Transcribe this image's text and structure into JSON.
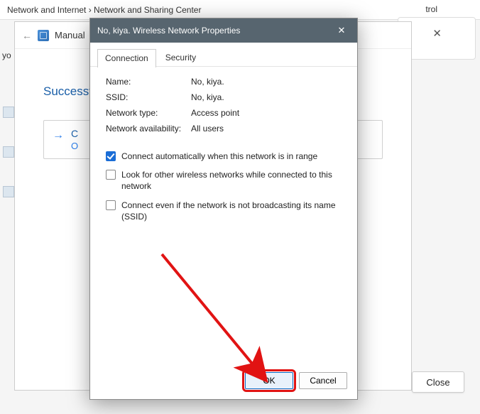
{
  "bg": {
    "breadcrumb": "Network and Internet  ›  Network and Sharing Center",
    "top_right": "trol"
  },
  "wizard": {
    "title": "Manual",
    "heading": "Successf",
    "option_main": "C",
    "option_sub": "O",
    "close_label": "Close",
    "yo_text": "yo"
  },
  "dialog": {
    "title": "No, kiya. Wireless Network Properties",
    "tabs": {
      "connection": "Connection",
      "security": "Security"
    },
    "fields": {
      "name_label": "Name:",
      "name_value": "No, kiya.",
      "ssid_label": "SSID:",
      "ssid_value": "No, kiya.",
      "type_label": "Network type:",
      "type_value": "Access point",
      "avail_label": "Network availability:",
      "avail_value": "All users"
    },
    "checkboxes": {
      "auto": "Connect automatically when this network is in range",
      "look": "Look for other wireless networks while connected to this network",
      "hidden": "Connect even if the network is not broadcasting its name (SSID)"
    },
    "buttons": {
      "ok": "OK",
      "cancel": "Cancel"
    }
  }
}
